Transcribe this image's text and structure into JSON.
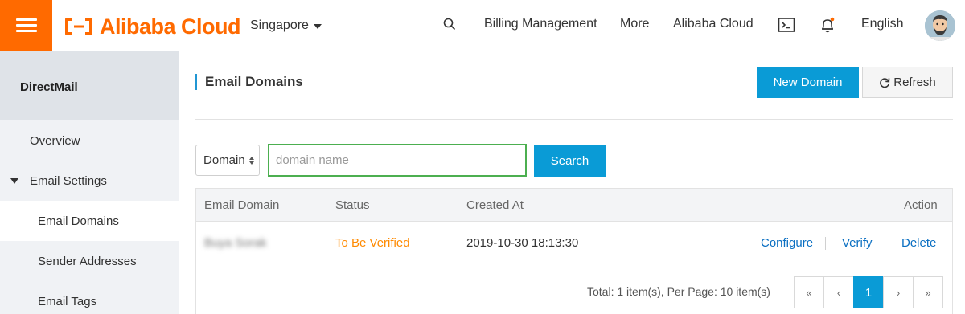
{
  "header": {
    "logo_text": "Alibaba Cloud",
    "region": "Singapore",
    "nav": [
      "Billing Management",
      "More",
      "Alibaba Cloud"
    ],
    "language": "English",
    "icons": [
      "menu-icon",
      "search-icon",
      "terminal-icon",
      "bell-icon",
      "avatar"
    ]
  },
  "sidebar": {
    "title": "DirectMail",
    "items": [
      {
        "label": "Overview"
      },
      {
        "label": "Email Settings"
      },
      {
        "label": "Email Domains"
      },
      {
        "label": "Sender Addresses"
      },
      {
        "label": "Email Tags"
      }
    ]
  },
  "main": {
    "title": "Email Domains",
    "new_domain_label": "New Domain",
    "refresh_label": "Refresh",
    "filter": {
      "select_value": "Domain",
      "input_placeholder": "domain name",
      "search_label": "Search"
    },
    "table": {
      "columns": [
        "Email Domain",
        "Status",
        "Created At",
        "Action"
      ],
      "rows": [
        {
          "domain": "Buya Sorak",
          "status": "To Be Verified",
          "created_at": "2019-10-30 18:13:30",
          "actions": [
            "Configure",
            "Verify",
            "Delete"
          ]
        }
      ]
    },
    "pagination": {
      "summary": "Total: 1 item(s), Per Page: 10 item(s)",
      "first": "«",
      "prev": "‹",
      "current": "1",
      "next": "›",
      "last": "»"
    }
  },
  "colors": {
    "brand_orange": "#ff6a00",
    "primary_blue": "#0a9bd6",
    "status_pending": "#ff8a00",
    "link_blue": "#0a6fc2"
  }
}
